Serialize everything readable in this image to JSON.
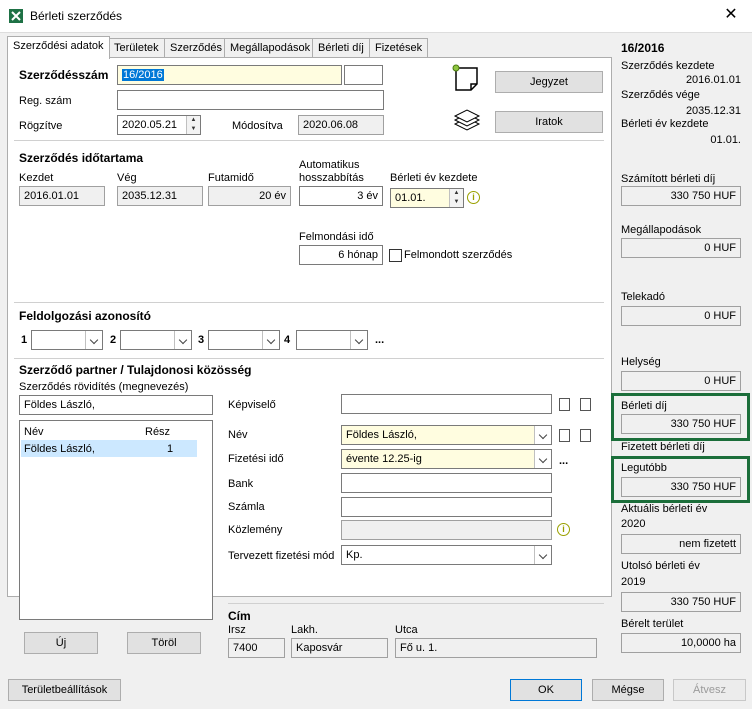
{
  "window": {
    "title": "Bérleti szerződés"
  },
  "tabs": [
    {
      "label": "Szerződési adatok"
    },
    {
      "label": "Területek"
    },
    {
      "label": "Szerződés"
    },
    {
      "label": "Megállapodások"
    },
    {
      "label": "Bérleti díj"
    },
    {
      "label": "Fizetések"
    }
  ],
  "contract": {
    "number_label": "Szerződésszám",
    "number_value": "16/2016",
    "reg_label": "Reg. szám",
    "reg_value": "",
    "recorded_label": "Rögzítve",
    "recorded_value": "2020.05.21",
    "modified_label": "Módosítva",
    "modified_value": "2020.06.08",
    "note_button": "Jegyzet",
    "docs_button": "Iratok"
  },
  "duration": {
    "heading": "Szerződés időtartama",
    "start_label": "Kezdet",
    "start_value": "2016.01.01",
    "end_label": "Vég",
    "end_value": "2035.12.31",
    "term_label": "Futamidő",
    "term_value": "20 év",
    "auto_label_1": "Automatikus",
    "auto_label_2": "hosszabbítás",
    "auto_value": "3 év",
    "year_start_label": "Bérleti év kezdete",
    "year_start_value": "01.01.",
    "notice_label": "Felmondási idő",
    "notice_value": "6 hónap",
    "terminated_label": "Felmondott szerződés"
  },
  "processing": {
    "heading": "Feldolgozási azonosító",
    "ids": [
      "1",
      "2",
      "3",
      "4"
    ],
    "more": "..."
  },
  "partner": {
    "heading": "Szerződő partner / Tulajdonosi közösség",
    "short_label": "Szerződés rövidítés (megnevezés)",
    "short_value": "Földes László,",
    "list_col_name": "Név",
    "list_col_share": "Rész",
    "list_rows": [
      {
        "name": "Földes László,",
        "share": "1"
      }
    ],
    "new_button": "Új",
    "delete_button": "Töröl",
    "rep_label": "Képviselő",
    "rep_value": "",
    "name_label": "Név",
    "name_value": "Földes László,",
    "payment_time_label": "Fizetési idő",
    "payment_time_value": "évente 12.25-ig",
    "payment_more": "...",
    "bank_label": "Bank",
    "bank_value": "",
    "account_label": "Számla",
    "account_value": "",
    "notice_label": "Közlemény",
    "notice_value": "",
    "planned_label": "Tervezett fizetési mód",
    "planned_value": "Kp."
  },
  "address": {
    "heading": "Cím",
    "zip_label": "Irsz",
    "zip_value": "7400",
    "city_label": "Lakh.",
    "city_value": "Kaposvár",
    "street_label": "Utca",
    "street_value": "Fő u. 1."
  },
  "side": {
    "title": "16/2016",
    "start_label": "Szerződés kezdete",
    "start_value": "2016.01.01",
    "end_label": "Szerződés vége",
    "end_value": "2035.12.31",
    "year_label": "Bérleti év kezdete",
    "year_value": "01.01.",
    "calc_label": "Számított bérleti díj",
    "calc_value": "330 750 HUF",
    "agree_label": "Megállapodások",
    "agree_value": "0 HUF",
    "tax_label": "Telekadó",
    "tax_value": "0 HUF",
    "place_label": "Helység",
    "place_value": "0 HUF",
    "rent_label": "Bérleti díj",
    "rent_value": "330 750 HUF",
    "paid_label": "Fizetett bérleti díj",
    "last_label": "Legutóbb",
    "last_value": "330 750 HUF",
    "current_label": "Aktuális bérleti év",
    "current_year": "2020",
    "current_value": "nem fizetett",
    "prev_label": "Utolsó bérleti év",
    "prev_year": "2019",
    "prev_value": "330 750 HUF",
    "area_label": "Bérelt terület",
    "area_value": "10,0000 ha"
  },
  "footer": {
    "area_settings": "Területbeállítások",
    "ok": "OK",
    "cancel": "Mégse",
    "transfer": "Átvesz"
  }
}
